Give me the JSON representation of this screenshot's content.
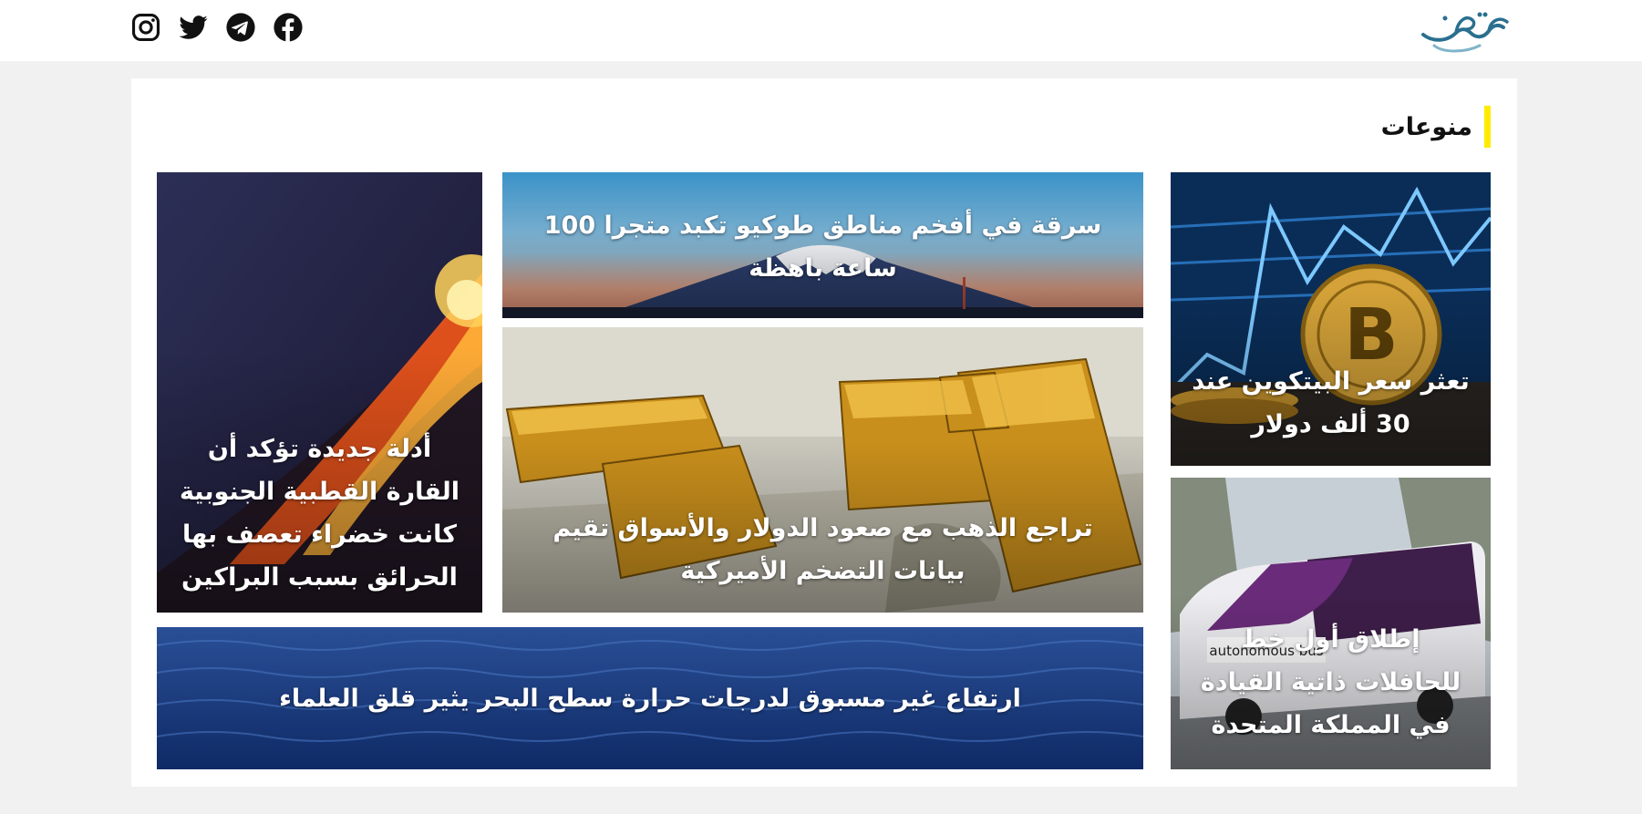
{
  "header": {
    "logo_alt": "صهيب",
    "social": [
      {
        "name": "instagram-icon",
        "label": "Instagram"
      },
      {
        "name": "twitter-icon",
        "label": "Twitter"
      },
      {
        "name": "telegram-icon",
        "label": "Telegram"
      },
      {
        "name": "facebook-icon",
        "label": "Facebook"
      }
    ]
  },
  "section": {
    "title": "منوعات",
    "accent_color": "#ffeb00"
  },
  "articles": {
    "tokyo": {
      "headline": "سرقة في أفخم مناطق طوكيو تكبد متجرا 100 ساعة باهظة",
      "image": "mount-fuji-city-image"
    },
    "gold": {
      "headline": "تراجع الذهب مع صعود الدولار والأسواق تقيم بيانات التضخم الأميركية",
      "image": "gold-bars-dollars-image"
    },
    "volcano": {
      "headline": "أدلة جديدة تؤكد أن القارة القطبية الجنوبية كانت خضراء تعصف بها الحرائق بسبب البراكين",
      "image": "erupting-volcano-image"
    },
    "bitcoin": {
      "headline": "تعثر سعر البيتكوين عند 30 ألف دولار",
      "image": "bitcoin-coin-chart-image"
    },
    "bus": {
      "headline": "إطلاق أول خط للحافلات ذاتية القيادة في المملكة المتحدة",
      "image": "autonomous-bus-image"
    },
    "sea": {
      "headline": "ارتفاع غير مسبوق لدرجات حرارة سطح البحر يثير قلق العلماء",
      "image": "ocean-surface-image"
    }
  }
}
